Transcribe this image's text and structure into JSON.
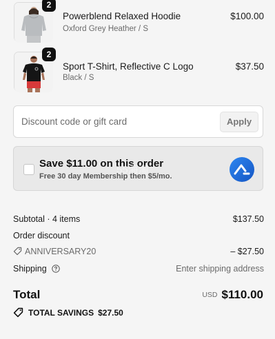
{
  "cart": {
    "items": [
      {
        "name": "Powerblend Relaxed Hoodie",
        "variant": "Oxford Grey Heather / S",
        "price": "$100.00",
        "quantity": "2"
      },
      {
        "name": "Sport T-Shirt, Reflective C Logo",
        "variant": "Black / S",
        "price": "$37.50",
        "quantity": "2"
      }
    ]
  },
  "discount": {
    "placeholder": "Discount code or gift card",
    "value": "",
    "apply_label": "Apply"
  },
  "promo": {
    "title": "Save $11.00 on this order",
    "subtitle": "Free 30 day Membership then $5/mo.",
    "watermark": "55海淘",
    "checked": false,
    "logo_icon": "brand-chevron-icon",
    "logo_color": "#1f6fd8"
  },
  "summary": {
    "subtotal_label": "Subtotal · 4 items",
    "subtotal_value": "$137.50",
    "order_discount_label": "Order discount",
    "discount_code": "ANNIVERSARY20",
    "discount_value": "– $27.50",
    "shipping_label": "Shipping",
    "shipping_value": "Enter shipping address",
    "total_label": "Total",
    "currency": "USD",
    "total_value": "$110.00",
    "savings_label": "TOTAL SAVINGS",
    "savings_value": "$27.50"
  }
}
